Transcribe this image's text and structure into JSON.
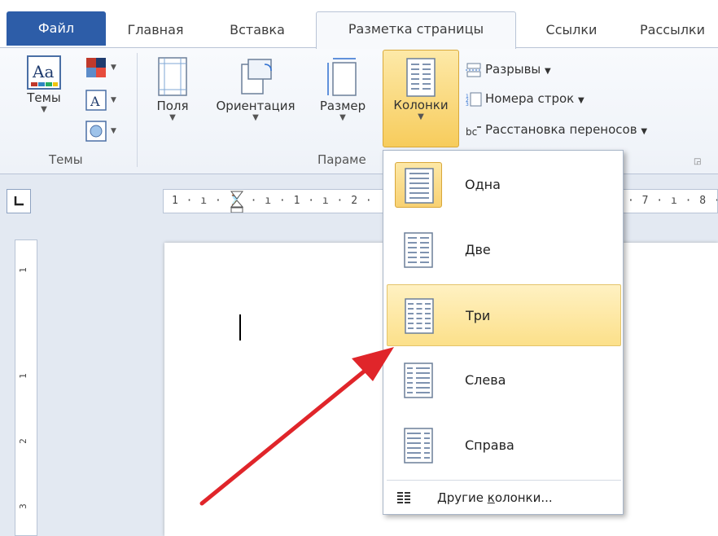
{
  "tabs": {
    "file": "Файл",
    "home": "Главная",
    "insert": "Вставка",
    "layout": "Разметка страницы",
    "references": "Ссылки",
    "mailings": "Рассылки"
  },
  "ribbon": {
    "themes_group": {
      "themes_label": "Темы",
      "group_label": "Темы"
    },
    "page_setup_group": {
      "margins_label": "Поля",
      "orientation_label": "Ориентация",
      "size_label": "Размер",
      "columns_label": "Колонки",
      "breaks_label": "Разрывы",
      "line_numbers_label": "Номера строк",
      "hyphenation_label": "Расстановка переносов",
      "group_label": "Параме"
    }
  },
  "ruler": {
    "horizontal_marks": "1 · ı · ⌛ · ı · 1 · ı · 2 ·",
    "horizontal_marks_right": "· 7 · ı · 8 ·",
    "vertical_marks": [
      "1",
      "1",
      "2",
      "3"
    ]
  },
  "columns_menu": {
    "items": [
      {
        "label": "Одна"
      },
      {
        "label": "Две"
      },
      {
        "label": "Три"
      },
      {
        "label": "Слева"
      },
      {
        "label": "Справа"
      }
    ],
    "more_prefix": "Другие ",
    "more_underlined": "к",
    "more_suffix": "олонки..."
  },
  "colors": {
    "file_tab": "#2d5da8",
    "highlight": "#fce08a",
    "arrow": "#e0252a"
  }
}
